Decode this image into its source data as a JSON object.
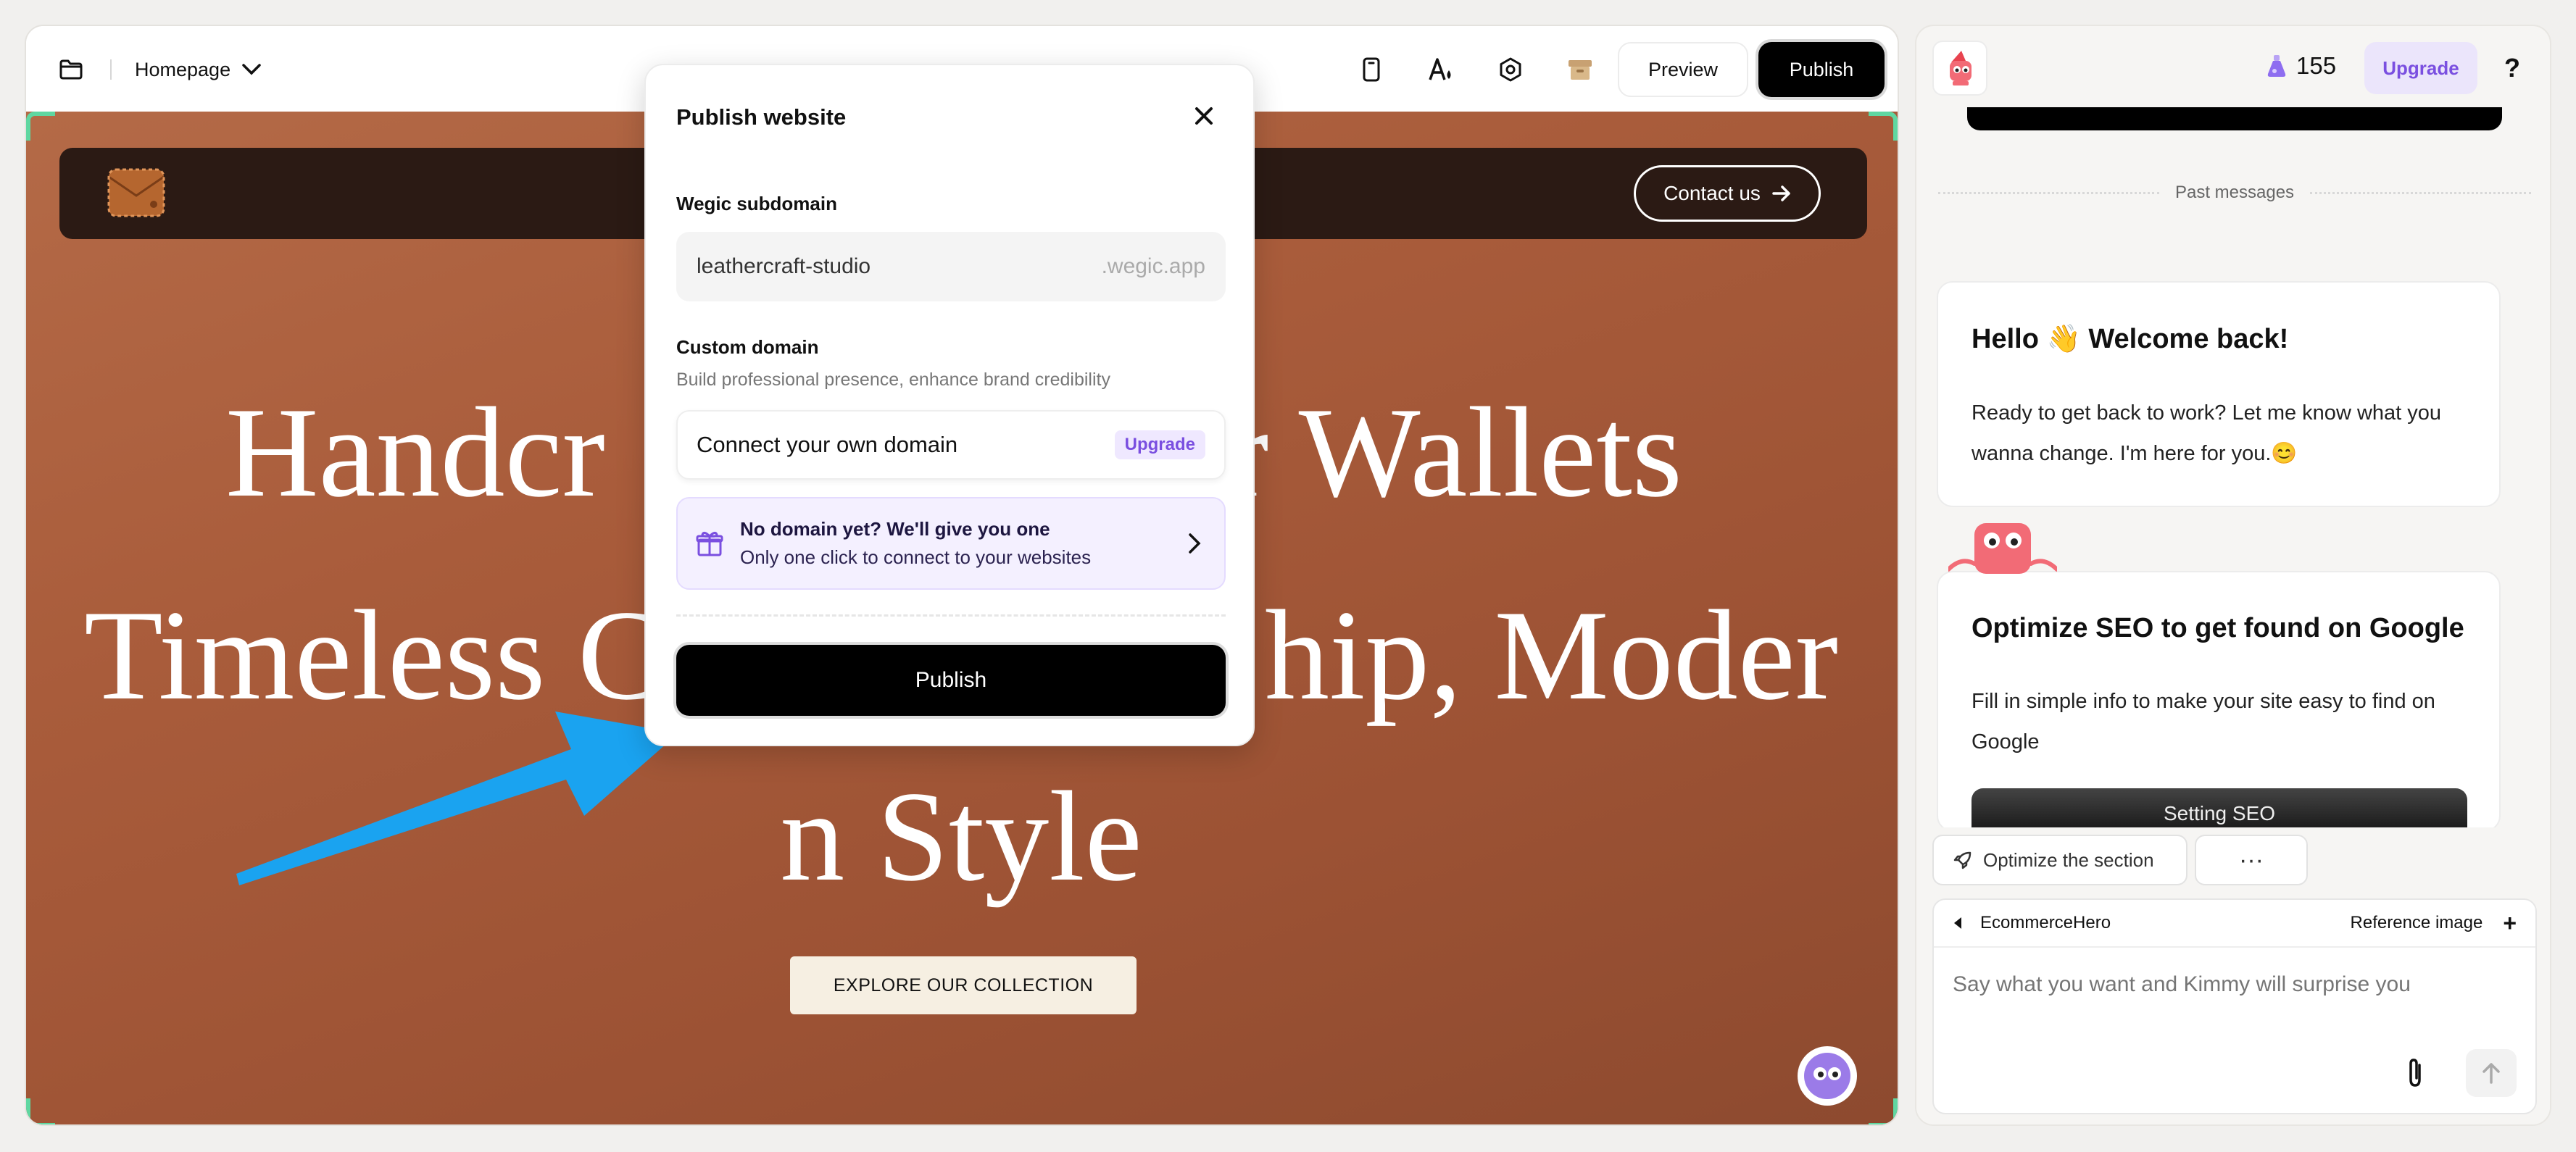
{
  "editor": {
    "page_select": {
      "label": "Homepage"
    },
    "actions": {
      "preview_label": "Preview",
      "publish_label": "Publish"
    },
    "icons": [
      "folder-icon",
      "chevron-down-icon",
      "mobile-icon",
      "font-color-icon",
      "settings-icon",
      "box-icon"
    ]
  },
  "site": {
    "contact_label": "Contact us",
    "hero_lines": [
      "Handcr",
      "er Wallets",
      "Timeless C",
      "hip, Moder",
      "n Style"
    ],
    "cta_label": "EXPLORE OUR COLLECTION",
    "colors": {
      "background": "#a95c3b",
      "nav": "#2b1a14",
      "cta": "#f6efe2"
    }
  },
  "modal": {
    "title": "Publish website",
    "subdomain_label": "Wegic subdomain",
    "subdomain_value": "leathercraft-studio",
    "subdomain_suffix": ".wegic.app",
    "custom_domain_label": "Custom domain",
    "custom_domain_desc": "Build professional presence, enhance brand credibility",
    "connect_label": "Connect your own domain",
    "upgrade_badge": "Upgrade",
    "promo_title": "No domain yet? We'll give you one",
    "promo_sub": "Only one click to connect to your websites",
    "publish_label": "Publish"
  },
  "chat": {
    "credits": "155",
    "upgrade_label": "Upgrade",
    "help_label": "?",
    "past_messages_label": "Past messages",
    "welcome": {
      "title": "Hello 👋 Welcome back!",
      "body": "Ready to get back to work? Let me know what you wanna change. I'm here for you.😊"
    },
    "seo": {
      "title": "Optimize SEO to get found on Google",
      "body": "Fill in simple info to make your site easy to find on Google",
      "button_label": "Setting SEO"
    },
    "optimize_label": "Optimize the section",
    "more_label": "···",
    "composer": {
      "context_name": "EcommerceHero",
      "reference_label": "Reference image",
      "add_label": "+",
      "placeholder": "Say what you want and Kimmy will surprise you"
    },
    "accent_color": "#7a4fe0"
  }
}
